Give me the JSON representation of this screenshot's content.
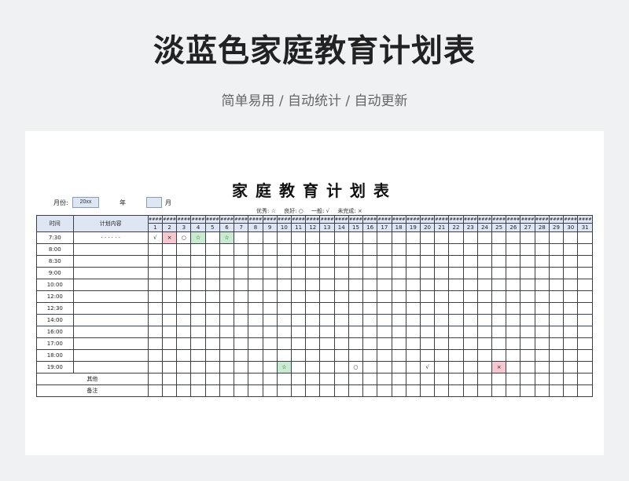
{
  "banner": {
    "title": "淡蓝色家庭教育计划表",
    "subtitle": "简单易用 / 自动统计 / 自动更新"
  },
  "doc": {
    "title": "家庭教育计划表",
    "month_label": "月份:",
    "month_value": "20xx",
    "year_label": "年",
    "month_unit": "月"
  },
  "legend": {
    "excellent": "优秀: ☆",
    "good": "良好: ○",
    "average": "一般: √",
    "incomplete": "未完成: ×"
  },
  "table": {
    "header_time": "时间",
    "header_plan": "计划内容",
    "weekday_placeholder": "####",
    "days": [
      "1",
      "2",
      "3",
      "4",
      "5",
      "6",
      "7",
      "8",
      "9",
      "10",
      "11",
      "12",
      "13",
      "14",
      "15",
      "16",
      "17",
      "18",
      "19",
      "20",
      "21",
      "22",
      "23",
      "24",
      "25",
      "26",
      "27",
      "28",
      "29",
      "30",
      "31"
    ],
    "rows": [
      {
        "time": "7:30",
        "plan": "· · · · · ·",
        "marks": {
          "1": [
            "√",
            ""
          ],
          "2": [
            "×",
            "pink"
          ],
          "3": [
            "○",
            ""
          ],
          "4": [
            "☆",
            "green"
          ],
          "6": [
            "☆",
            "green"
          ]
        }
      },
      {
        "time": "8:00",
        "plan": "",
        "marks": {}
      },
      {
        "time": "8:30",
        "plan": "",
        "marks": {}
      },
      {
        "time": "9:00",
        "plan": "",
        "marks": {}
      },
      {
        "time": "10:00",
        "plan": "",
        "marks": {}
      },
      {
        "time": "12:00",
        "plan": "",
        "marks": {}
      },
      {
        "time": "12:30",
        "plan": "",
        "marks": {}
      },
      {
        "time": "14:00",
        "plan": "",
        "marks": {}
      },
      {
        "time": "16:00",
        "plan": "",
        "marks": {}
      },
      {
        "time": "17:00",
        "plan": "",
        "marks": {}
      },
      {
        "time": "18:00",
        "plan": "",
        "marks": {}
      },
      {
        "time": "19:00",
        "plan": "",
        "marks": {
          "10": [
            "☆",
            "green"
          ],
          "15": [
            "○",
            ""
          ],
          "20": [
            "√",
            ""
          ],
          "25": [
            "×",
            "pink"
          ]
        }
      }
    ],
    "footer_rows": [
      "其他",
      "备注"
    ]
  }
}
